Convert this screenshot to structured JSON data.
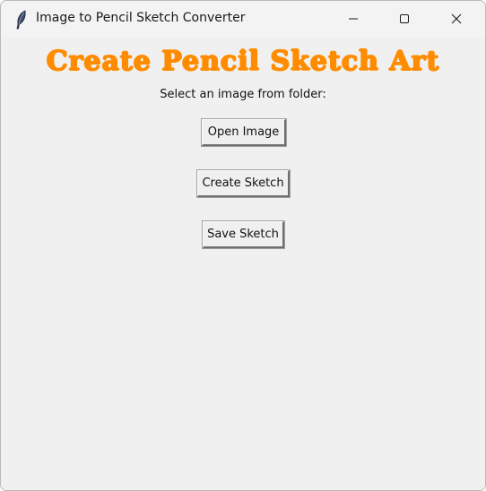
{
  "window": {
    "title": "Image to Pencil Sketch Converter",
    "app_icon": "feather-icon",
    "controls": {
      "minimize": "minimize-icon",
      "maximize": "maximize-icon",
      "close": "close-icon"
    }
  },
  "main": {
    "heading": "Create Pencil Sketch Art",
    "heading_color": "#ff8c00",
    "prompt": "Select an image from folder:",
    "buttons": {
      "open": "Open Image",
      "create": "Create Sketch",
      "save": "Save Sketch"
    }
  }
}
